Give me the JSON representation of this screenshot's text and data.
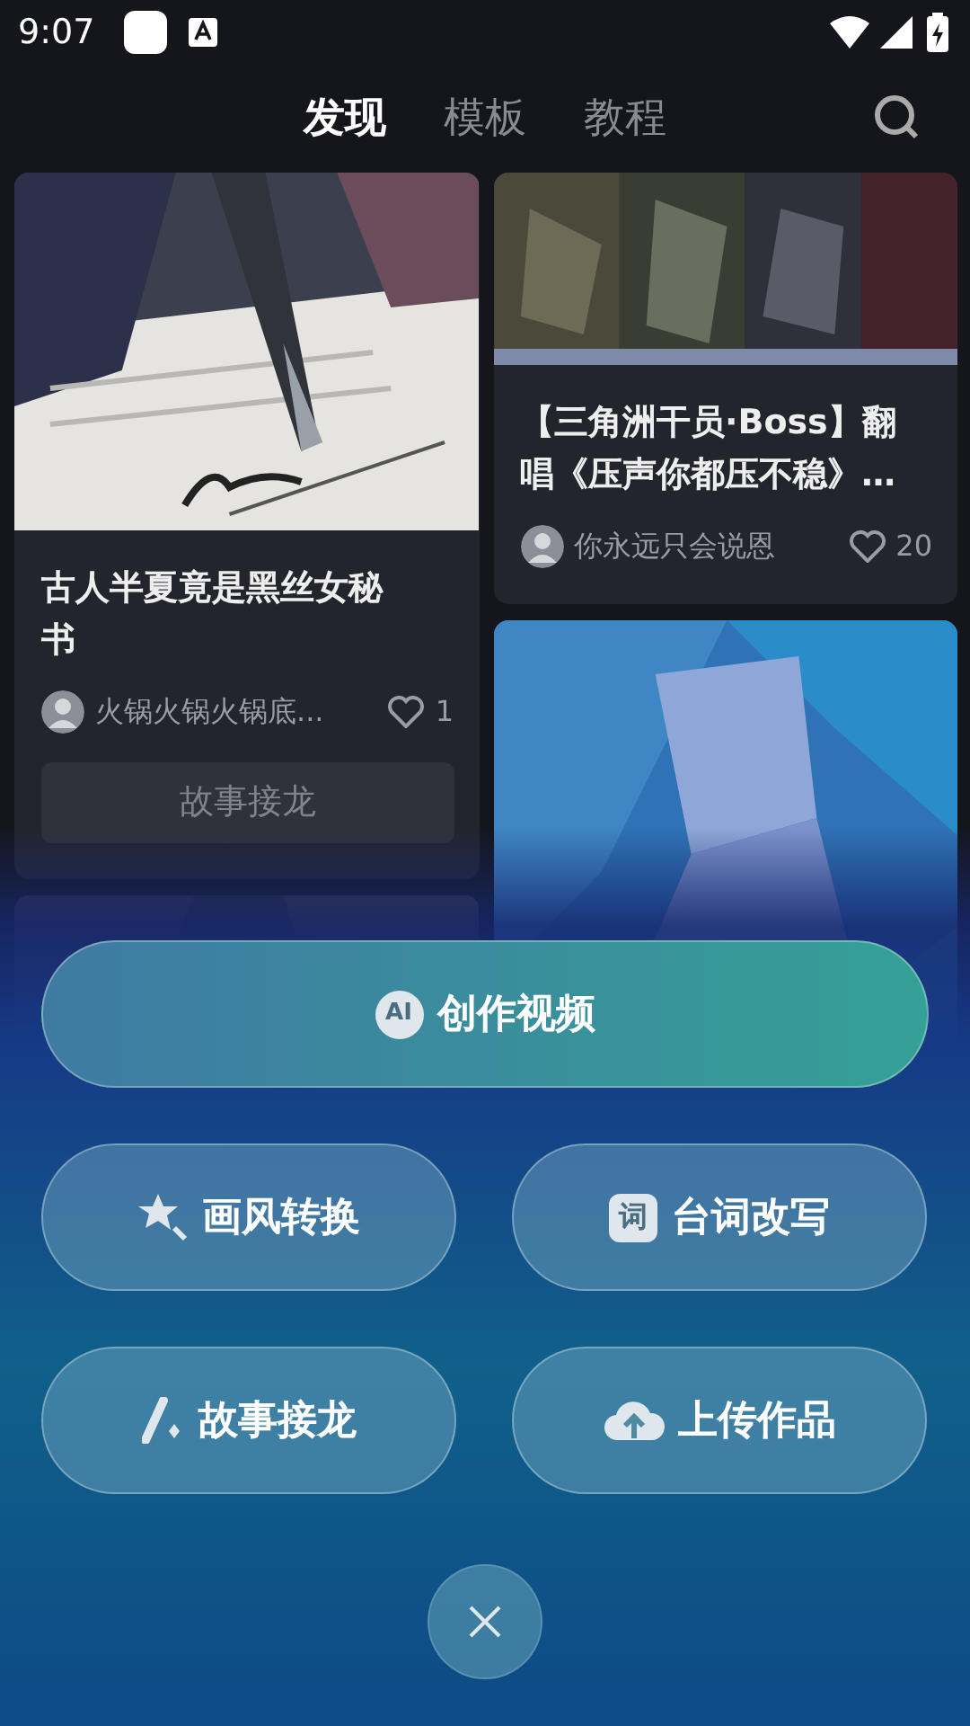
{
  "status_bar": {
    "time": "9:07"
  },
  "tabs": [
    {
      "label": "发现",
      "selected": true
    },
    {
      "label": "模板",
      "selected": false
    },
    {
      "label": "教程",
      "selected": false
    }
  ],
  "feed": {
    "columns": [
      [
        {
          "kind": "post",
          "title": "古人半夏竟是黑丝女秘书",
          "author": "火锅火锅火锅底...",
          "likes": "1",
          "action": "故事接龙"
        },
        {
          "kind": "picture"
        }
      ],
      [
        {
          "kind": "post",
          "title": "【三角洲干员·Boss】翻唱《压声你都压不稳》…",
          "author": "你永远只会说恩",
          "likes": "20"
        },
        {
          "kind": "picture"
        }
      ]
    ]
  },
  "menu": {
    "primary": {
      "badge": "AI",
      "label": "创作视频"
    },
    "actions": [
      {
        "label": "画风转换"
      },
      {
        "badge": "词",
        "label": "台词改写"
      },
      {
        "label": "故事接龙"
      },
      {
        "label": "上传作品"
      }
    ]
  }
}
